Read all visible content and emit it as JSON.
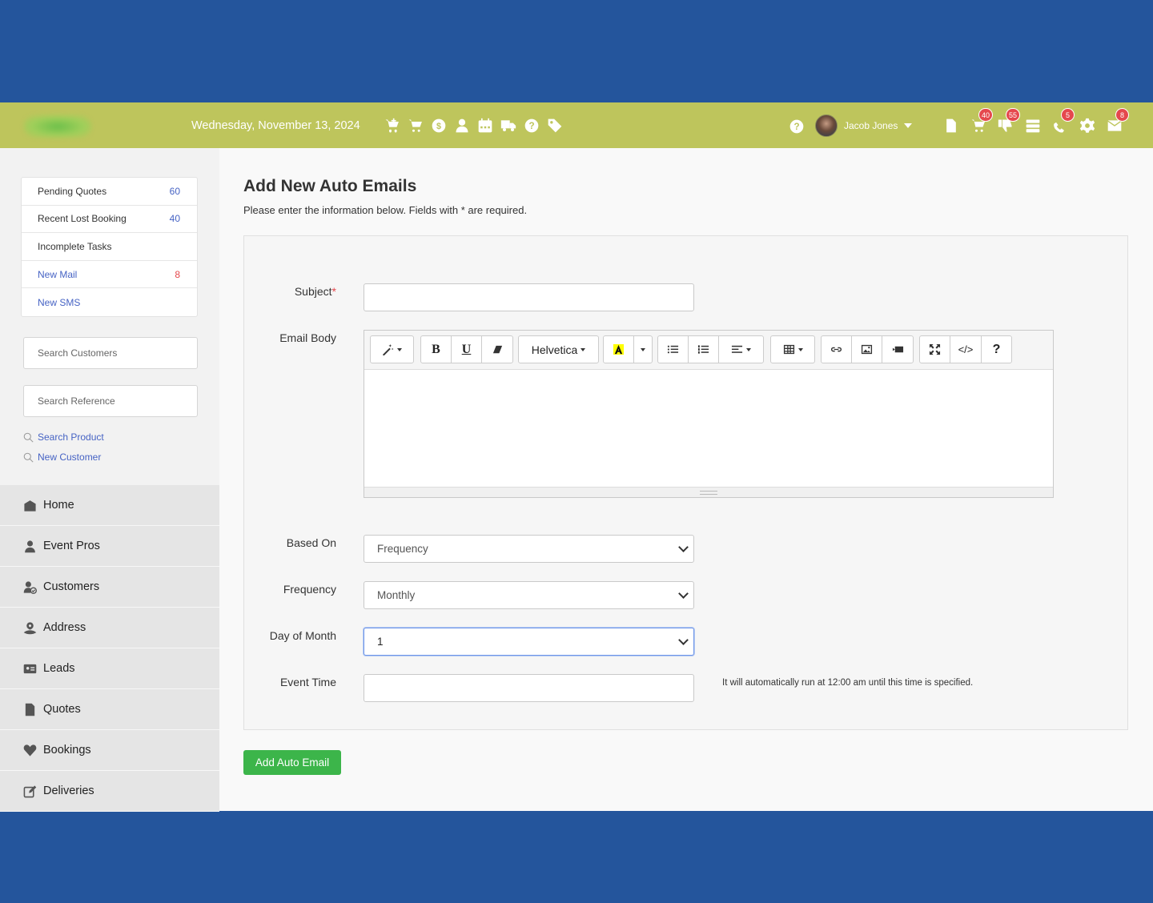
{
  "header": {
    "date": "Wednesday, November 13, 2024",
    "quick_icons": [
      "cart-plus-icon",
      "cart-icon",
      "dollar-icon",
      "user-icon",
      "calendar-icon",
      "truck-icon",
      "help-icon",
      "tag-icon"
    ],
    "user_name": "Jacob Jones",
    "badges": {
      "cart": "40",
      "alerts": "55",
      "phone": "5",
      "mail": "8"
    }
  },
  "sidebar": {
    "quick_list": [
      {
        "label": "Pending Quotes",
        "count": "60"
      },
      {
        "label": "Recent Lost Booking",
        "count": "40"
      },
      {
        "label": "Incomplete Tasks",
        "count": ""
      },
      {
        "label": "New Mail",
        "count": "8"
      },
      {
        "label": "New SMS",
        "count": ""
      }
    ],
    "search_customers_placeholder": "Search Customers",
    "search_reference_placeholder": "Search Reference",
    "links": [
      "Search Product",
      "New Customer"
    ],
    "nav": [
      "Home",
      "Event Pros",
      "Customers",
      "Address",
      "Leads",
      "Quotes",
      "Bookings",
      "Deliveries"
    ]
  },
  "main": {
    "title": "Add New Auto Emails",
    "subtitle": "Please enter the information below. Fields with * are required.",
    "labels": {
      "subject": "Subject",
      "required_mark": "*",
      "email_body": "Email Body",
      "based_on": "Based On",
      "frequency": "Frequency",
      "day_of_month": "Day of Month",
      "event_time": "Event Time"
    },
    "values": {
      "subject": "",
      "based_on": "Frequency",
      "frequency": "Monthly",
      "day_of_month": "1",
      "event_time": ""
    },
    "editor": {
      "font": "Helvetica",
      "bold": "B",
      "underline": "U",
      "help": "?",
      "code": "</>"
    },
    "hint": "It will automatically run at 12:00 am until this time is specified.",
    "submit_label": "Add Auto Email"
  },
  "colors": {
    "topbar": "#bec55c",
    "frame": "#24559c",
    "link": "#4663c4",
    "badge": "#e5484d",
    "submit": "#3cb54a"
  }
}
